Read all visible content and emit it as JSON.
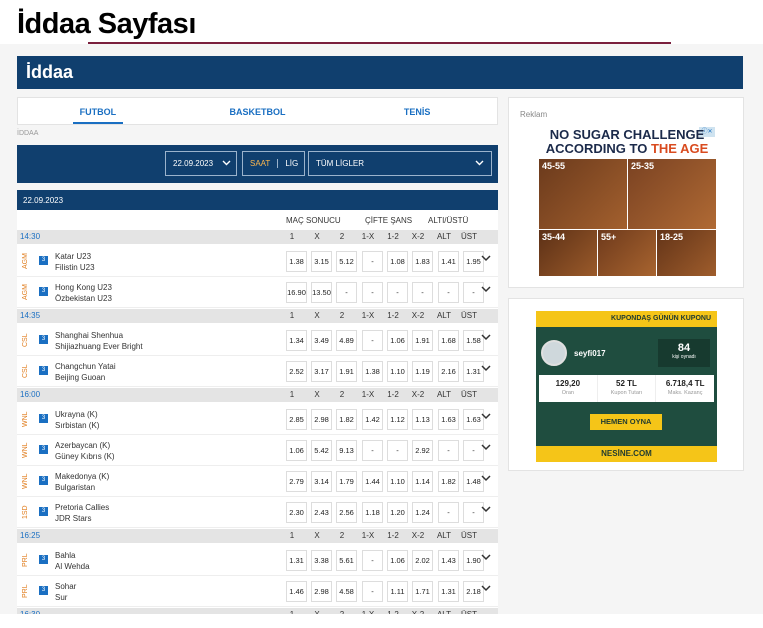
{
  "page_title": "İddaa Sayfası",
  "header": {
    "title": "İddaa"
  },
  "tabs": [
    "FUTBOL",
    "BASKETBOL",
    "TENİS"
  ],
  "breadcrumb": "İDDAA",
  "filters": {
    "date": "22.09.2023",
    "saat": "SAAT",
    "lig": "LİG",
    "league": "TÜM LİGLER"
  },
  "date_label": "22.09.2023",
  "group_headers": {
    "mac_sonucu": "MAÇ SONUCU",
    "cifte_sans": "ÇİFTE ŞANS",
    "alt_ust": "ALTI/ÜSTÜ"
  },
  "columns": [
    "1",
    "X",
    "2",
    "1-X",
    "1-2",
    "X-2",
    "ALT",
    "ÜST"
  ],
  "time_groups": [
    {
      "time": "14:30",
      "matches": [
        {
          "league": "AGM",
          "badge": "3",
          "home": "Katar U23",
          "away": "Filistin U23",
          "odds": [
            "1.38",
            "3.15",
            "5.12",
            "-",
            "1.08",
            "1.83",
            "1.41",
            "1.95"
          ]
        },
        {
          "league": "AGM",
          "badge": "3",
          "home": "Hong Kong U23",
          "away": "Özbekistan U23",
          "odds": [
            "16.90",
            "13.50",
            "-",
            "-",
            "-",
            "-",
            "-",
            "-"
          ]
        }
      ]
    },
    {
      "time": "14:35",
      "matches": [
        {
          "league": "CSL",
          "badge": "3",
          "home": "Shanghai Shenhua",
          "away": "Shijiazhuang Ever Bright",
          "odds": [
            "1.34",
            "3.49",
            "4.89",
            "-",
            "1.06",
            "1.91",
            "1.68",
            "1.58"
          ]
        },
        {
          "league": "CSL",
          "badge": "3",
          "home": "Changchun Yatai",
          "away": "Beijing Guoan",
          "odds": [
            "2.52",
            "3.17",
            "1.91",
            "1.38",
            "1.10",
            "1.19",
            "2.16",
            "1.31"
          ]
        }
      ]
    },
    {
      "time": "16:00",
      "matches": [
        {
          "league": "WNL",
          "badge": "3",
          "home": "Ukrayna (K)",
          "away": "Sırbistan (K)",
          "odds": [
            "2.85",
            "2.98",
            "1.82",
            "1.42",
            "1.12",
            "1.13",
            "1.63",
            "1.63"
          ]
        },
        {
          "league": "WNL",
          "badge": "3",
          "home": "Azerbaycan (K)",
          "away": "Güney Kıbrıs (K)",
          "odds": [
            "1.06",
            "5.42",
            "9.13",
            "-",
            "-",
            "2.92",
            "-",
            "-"
          ]
        },
        {
          "league": "WNL",
          "badge": "3",
          "home": "Makedonya (K)",
          "away": "Bulgaristan",
          "odds": [
            "2.79",
            "3.14",
            "1.79",
            "1.44",
            "1.10",
            "1.14",
            "1.82",
            "1.48"
          ]
        },
        {
          "league": "1SD",
          "badge": "3",
          "home": "Pretoria Callies",
          "away": "JDR Stars",
          "odds": [
            "2.30",
            "2.43",
            "2.56",
            "1.18",
            "1.20",
            "1.24",
            "-",
            "-"
          ]
        }
      ]
    },
    {
      "time": "16:25",
      "matches": [
        {
          "league": "PRL",
          "badge": "3",
          "home": "Bahla",
          "away": "Al Wehda",
          "odds": [
            "1.31",
            "3.38",
            "5.61",
            "-",
            "1.06",
            "2.02",
            "1.43",
            "1.90"
          ]
        },
        {
          "league": "PRL",
          "badge": "3",
          "home": "Sohar",
          "away": "Sur",
          "odds": [
            "1.46",
            "2.98",
            "4.58",
            "-",
            "1.11",
            "1.71",
            "1.31",
            "2.18"
          ]
        }
      ]
    },
    {
      "time": "16:30",
      "matches": []
    }
  ],
  "ad": {
    "label": "Reklam",
    "close": "ⓘ✕",
    "headline_1a": "NO SUGAR",
    "headline_1b": " CHALLENGE",
    "headline_2a": "ACCORDING TO ",
    "headline_2b": "THE AGE",
    "cells": [
      "45-55",
      "25-35",
      "35-44",
      "55+",
      "18-25"
    ]
  },
  "coupon": {
    "banner": "KUPONDAŞ GÜNÜN KUPONU",
    "user": "seyfi017",
    "count": "84",
    "count_label": "kişi oynadı",
    "stats": [
      {
        "value": "129,20",
        "label": "Oran"
      },
      {
        "value": "52 TL",
        "label": "Kupon Tutarı"
      },
      {
        "value": "6.718,4 TL",
        "label": "Maks. Kazanç"
      }
    ],
    "play_button": "HEMEN OYNA",
    "brand": "NESİNE.COM"
  },
  "colors": {
    "navy": "#103f6e",
    "accent_blue": "#1a6fc2",
    "orange": "#e07b1a",
    "title_rule": "#7a1f3d"
  }
}
